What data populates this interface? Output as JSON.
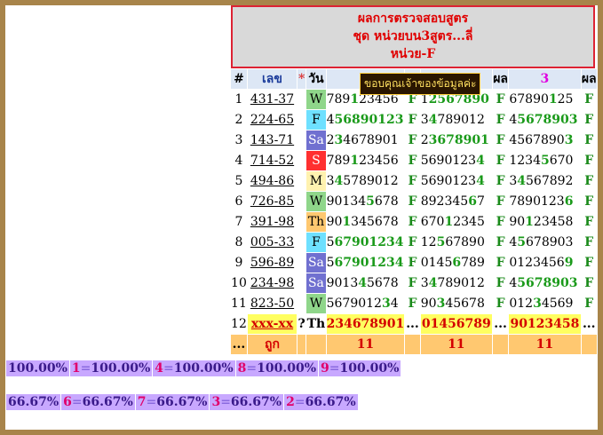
{
  "header": {
    "line1": "ผลการตรวจสอบสูตร",
    "line2": "ชุด หน่วยบน3สูตร...ลี่",
    "line3": "หน่วย-F"
  },
  "banner": "ขอบคุณเจ้าของข้อมูลค่ะ",
  "columns": {
    "hash": "#",
    "code": "เลข",
    "star": "*",
    "day": "วัน",
    "result1": "ผล",
    "group3": "3",
    "result2": "ผล"
  },
  "rows": [
    {
      "n": "1",
      "code": "431-37",
      "day": "W",
      "g1": [
        "789",
        "1",
        "23456"
      ],
      "f1": "F",
      "g2": [
        "1",
        "2567890"
      ],
      "f2": "F",
      "g3": [
        "67890",
        "1",
        "25"
      ],
      "f3": "F"
    },
    {
      "n": "2",
      "code": "224-65",
      "day": "F",
      "g1": [
        "4",
        "56890123"
      ],
      "f1": "F",
      "g2": [
        "3",
        "4",
        "789012"
      ],
      "f2": "F",
      "g3": [
        "4",
        "5678903"
      ],
      "f3": "F"
    },
    {
      "n": "3",
      "code": "143-71",
      "day": "Sa",
      "g1": [
        "2",
        "3",
        "4678901"
      ],
      "f1": "F",
      "g2": [
        "2",
        "3678901"
      ],
      "f2": "F",
      "g3": [
        "4567890",
        "3"
      ],
      "f3": "F"
    },
    {
      "n": "4",
      "code": "714-52",
      "day": "S",
      "g1": [
        "789",
        "1",
        "23456"
      ],
      "f1": "F",
      "g2": [
        "5690123",
        "4"
      ],
      "f2": "F",
      "g3": [
        "1234",
        "5",
        "670"
      ],
      "f3": "F"
    },
    {
      "n": "5",
      "code": "494-86",
      "day": "M",
      "g1": [
        "3",
        "4",
        "5789012"
      ],
      "f1": "F",
      "g2": [
        "5690123",
        "4"
      ],
      "f2": "F",
      "g3": [
        "3",
        "4",
        "567892"
      ],
      "f3": "F"
    },
    {
      "n": "6",
      "code": "726-85",
      "day": "W",
      "g1": [
        "90134",
        "5",
        "678"
      ],
      "f1": "F",
      "g2": [
        "892345",
        "6",
        "7"
      ],
      "f2": "F",
      "g3": [
        "7890123",
        "6"
      ],
      "f3": "F"
    },
    {
      "n": "7",
      "code": "391-98",
      "day": "Th",
      "g1": [
        "90",
        "1",
        "345678"
      ],
      "f1": "F",
      "g2": [
        "670",
        "1",
        "2345"
      ],
      "f2": "F",
      "g3": [
        "90",
        "1",
        "23458"
      ],
      "f3": "F"
    },
    {
      "n": "8",
      "code": "005-33",
      "day": "F",
      "g1": [
        "5",
        "67901234"
      ],
      "f1": "F",
      "g2": [
        "12",
        "5",
        "67890"
      ],
      "f2": "F",
      "g3": [
        "4",
        "5",
        "678903"
      ],
      "f3": "F"
    },
    {
      "n": "9",
      "code": "596-89",
      "day": "Sa",
      "g1": [
        "5",
        "67901234"
      ],
      "f1": "F",
      "g2": [
        "0145",
        "6",
        "789"
      ],
      "f2": "F",
      "g3": [
        "0123456",
        "9"
      ],
      "f3": "F"
    },
    {
      "n": "10",
      "code": "234-98",
      "day": "Sa",
      "g1": [
        "9013",
        "4",
        "5678"
      ],
      "f1": "F",
      "g2": [
        "3",
        "4",
        "789012"
      ],
      "f2": "F",
      "g3": [
        "4",
        "5678903"
      ],
      "f3": "F"
    },
    {
      "n": "11",
      "code": "823-50",
      "day": "W",
      "g1": [
        "5679012",
        "3",
        "4"
      ],
      "f1": "F",
      "g2": [
        "90",
        "3",
        "45678"
      ],
      "f2": "F",
      "g3": [
        "012",
        "3",
        "4569"
      ],
      "f3": "F"
    }
  ],
  "prediction": {
    "n": "12",
    "code": "xxx-xx",
    "star": "?",
    "day": "Th",
    "g1": "234678901",
    "dots1": "...",
    "g2": "01456789",
    "dots2": "...",
    "g3": "90123458",
    "dots3": "..."
  },
  "count_row": {
    "n": "...",
    "label": "ถูก",
    "c1": "11",
    "c2": "11",
    "c3": "11"
  },
  "stats_row1": [
    {
      "n": "",
      "eq": "",
      "v": "100.00%"
    },
    {
      "n": "1",
      "eq": "=",
      "v": "100.00%"
    },
    {
      "n": "4",
      "eq": "=",
      "v": "100.00%"
    },
    {
      "n": "8",
      "eq": "=",
      "v": "100.00%"
    },
    {
      "n": "9",
      "eq": "=",
      "v": "100.00%"
    }
  ],
  "stats_row2": [
    {
      "n": "",
      "eq": "",
      "v": "66.67%"
    },
    {
      "n": "6",
      "eq": "=",
      "v": "66.67%"
    },
    {
      "n": "7",
      "eq": "=",
      "v": "66.67%"
    },
    {
      "n": "3",
      "eq": "=",
      "v": "66.67%"
    },
    {
      "n": "2",
      "eq": "=",
      "v": "66.67%"
    }
  ]
}
